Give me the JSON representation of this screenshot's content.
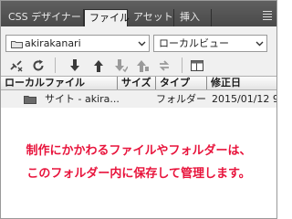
{
  "tabs": [
    {
      "label": "CSS デザイナー",
      "active": false
    },
    {
      "label": "ファイル",
      "active": true
    },
    {
      "label": "アセット",
      "active": false
    },
    {
      "label": "挿入",
      "active": false
    }
  ],
  "site_select": {
    "value": "akirakanari"
  },
  "view_select": {
    "value": "ローカルビュー"
  },
  "toolbar_icons": [
    "connect-icon",
    "refresh-icon",
    "get-files-icon",
    "put-files-icon",
    "check-out-icon",
    "check-in-icon",
    "sync-icon",
    "expand-icon"
  ],
  "table": {
    "columns": [
      "ローカルファイル",
      "サイズ",
      "タイプ",
      "修正日"
    ],
    "rows": [
      {
        "name": "サイト - akira...",
        "size": "",
        "type": "フォルダー",
        "modified": "2015/01/12 9:"
      }
    ]
  },
  "annotation": {
    "line1": "制作にかかわるファイルやフォルダーは、",
    "line2": "このフォルダー内に保存して管理します。",
    "color": "#e8143c"
  }
}
